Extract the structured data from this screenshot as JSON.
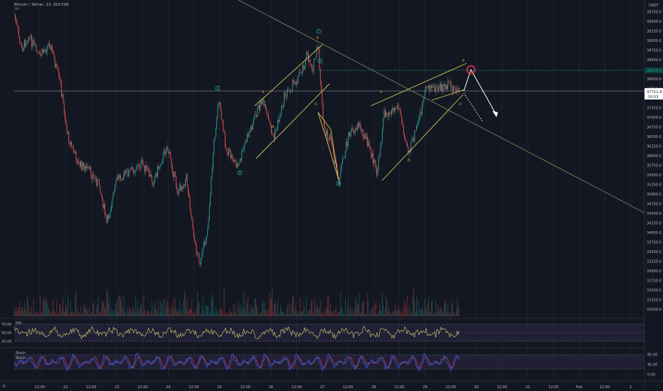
{
  "header": {
    "symbol": "Bitcoin / Tether, 15, KUCOIN",
    "sub": "Vol"
  },
  "colors": {
    "background": "#131722",
    "up": "#26a69a",
    "down": "#ef5350",
    "trend": "#d4c85a",
    "downtrend": "#8c8a5e",
    "rsi": "#e4d36f",
    "stoch_k": "#2962ff",
    "stoch_d": "#e0393e",
    "current_price_line": "#26a69a"
  },
  "price_axis": {
    "currency": "USDT",
    "ticks": [
      "39750.0",
      "39500.0",
      "39250.0",
      "39000.0",
      "38750.0",
      "38500.0",
      "38250.0",
      "38000.0",
      "37750.0",
      "37500.0",
      "37250.0",
      "37000.0",
      "36750.0",
      "36500.0",
      "36250.0",
      "36000.0",
      "35750.0",
      "35500.0",
      "35250.0",
      "35000.0",
      "34750.0",
      "34500.0",
      "34250.0",
      "34000.0",
      "33750.0",
      "33500.0",
      "33250.0",
      "33000.0",
      "32750.0",
      "32500.0",
      "32250.0",
      "32000.0"
    ],
    "alert_price": "38334.4",
    "current_price": "37711.9",
    "countdown": "10:53"
  },
  "time_axis": {
    "ticks": [
      "12:00",
      "22",
      "12:00",
      "23",
      "12:00",
      "24",
      "12:00",
      "25",
      "12:00",
      "26",
      "12:00",
      "27",
      "12:00",
      "28",
      "12:00",
      "29",
      "12:00",
      "30",
      "12:00",
      "31",
      "12:00",
      "Feb",
      "12:00",
      "2"
    ]
  },
  "wave_labels": {
    "a1": "A",
    "b1": "B",
    "c1": "C",
    "e1": "E",
    "d1": "D",
    "a2": "A",
    "b2": "B",
    "e2": "E",
    "d2": "D",
    "circ_a": "A",
    "circ_b": "B",
    "circ_c": "C",
    "circ_d": "D",
    "circ_e": "E"
  },
  "rsi": {
    "label": "RSI",
    "ticks": [
      "75.00",
      "50.00",
      "25.00"
    ]
  },
  "stoch": {
    "label1": "Stoch",
    "label2": "Stoch",
    "ticks": [
      "80.00",
      "40.00",
      "0.00"
    ]
  }
}
